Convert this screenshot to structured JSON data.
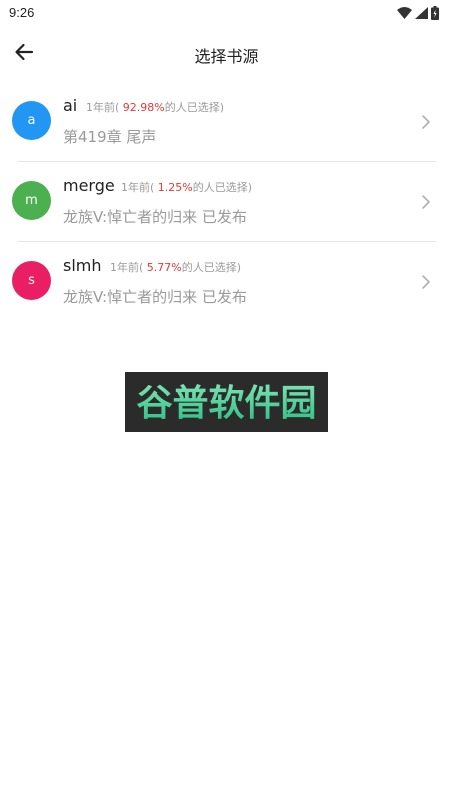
{
  "status_bar": {
    "time": "9:26"
  },
  "header": {
    "title": "选择书源"
  },
  "sources": [
    {
      "initial": "a",
      "name": "ai",
      "meta_prefix": "1年前(",
      "percent": "92.98%",
      "meta_suffix": "的人已选择)",
      "chapter": "第419章 尾声",
      "avatar_color": "#2196f3"
    },
    {
      "initial": "m",
      "name": "merge",
      "meta_prefix": "1年前(",
      "percent": "1.25%",
      "meta_suffix": "的人已选择)",
      "chapter": "龙族V:悼亡者的归来 已发布",
      "avatar_color": "#4caf50"
    },
    {
      "initial": "s",
      "name": "slmh",
      "meta_prefix": "1年前(",
      "percent": "5.77%",
      "meta_suffix": "的人已选择)",
      "chapter": "龙族V:悼亡者的归来 已发布",
      "avatar_color": "#e91e63"
    }
  ],
  "watermark": {
    "text": "谷普软件园"
  }
}
